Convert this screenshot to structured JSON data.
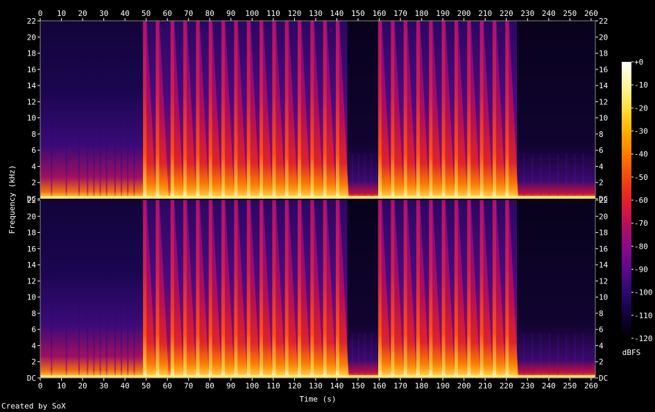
{
  "chart_data": {
    "type": "heatmap",
    "title": "",
    "xlabel": "Time (s)",
    "ylabel": "Frequency (kHz)",
    "xlim": [
      0,
      262
    ],
    "ylim": [
      0,
      22
    ],
    "x_ticks": [
      0,
      10,
      20,
      30,
      40,
      50,
      60,
      70,
      80,
      90,
      100,
      110,
      120,
      130,
      140,
      150,
      160,
      170,
      180,
      190,
      200,
      210,
      220,
      230,
      240,
      250,
      260
    ],
    "channels": [
      {
        "y_ticks": [
          {
            "value": 0,
            "label": "DC"
          },
          {
            "value": 2,
            "label": "2"
          },
          {
            "value": 4,
            "label": "4"
          },
          {
            "value": 6,
            "label": "6"
          },
          {
            "value": 8,
            "label": "8"
          },
          {
            "value": 10,
            "label": "10"
          },
          {
            "value": 12,
            "label": "12"
          },
          {
            "value": 14,
            "label": "14"
          },
          {
            "value": 16,
            "label": "16"
          },
          {
            "value": 18,
            "label": "18"
          },
          {
            "value": 20,
            "label": "20"
          },
          {
            "value": 22,
            "label": "22"
          }
        ]
      },
      {
        "y_ticks": [
          {
            "value": 0,
            "label": "DC"
          },
          {
            "value": 2,
            "label": "2"
          },
          {
            "value": 4,
            "label": "4"
          },
          {
            "value": 6,
            "label": "6"
          },
          {
            "value": 8,
            "label": "8"
          },
          {
            "value": 10,
            "label": "10"
          },
          {
            "value": 12,
            "label": "12"
          },
          {
            "value": 14,
            "label": "14"
          },
          {
            "value": 16,
            "label": "16"
          },
          {
            "value": 18,
            "label": "18"
          },
          {
            "value": 20,
            "label": "20"
          },
          {
            "value": 22,
            "label": "22"
          }
        ]
      }
    ],
    "colorbar": {
      "label": "dBFS",
      "range": [
        -120,
        0
      ],
      "ticks": [
        {
          "value": 0,
          "label": "+0"
        },
        {
          "value": -10,
          "label": "-10"
        },
        {
          "value": -20,
          "label": "-20"
        },
        {
          "value": -30,
          "label": "-30"
        },
        {
          "value": -40,
          "label": "-40"
        },
        {
          "value": -50,
          "label": "-50"
        },
        {
          "value": -60,
          "label": "-60"
        },
        {
          "value": -70,
          "label": "-70"
        },
        {
          "value": -80,
          "label": "-80"
        },
        {
          "value": -90,
          "label": "-90"
        },
        {
          "value": -100,
          "label": "-100"
        },
        {
          "value": -110,
          "label": "-110"
        },
        {
          "value": -120,
          "label": "-120"
        }
      ],
      "colors": [
        "#000000",
        "#14003a",
        "#2a0a6e",
        "#5a0a8a",
        "#8a0a88",
        "#b8105a",
        "#e0202a",
        "#f04a10",
        "#ff7a00",
        "#ffb000",
        "#ffe040",
        "#fff6a0",
        "#ffffff"
      ]
    },
    "segments": [
      {
        "t0": 0,
        "t1": 49,
        "character": "quiet intro, soft onsets"
      },
      {
        "t0": 49,
        "t1": 145,
        "character": "strong percussive onsets"
      },
      {
        "t0": 145,
        "t1": 160,
        "character": "sparse, low energy"
      },
      {
        "t0": 160,
        "t1": 225,
        "character": "strong percussive onsets"
      },
      {
        "t0": 225,
        "t1": 262,
        "character": "sparse, low energy"
      }
    ],
    "strong_onsets": [
      49,
      55,
      62,
      68,
      74,
      80,
      86,
      92,
      98,
      104,
      110,
      116,
      122,
      128,
      134,
      140,
      160,
      166,
      172,
      178,
      184,
      190,
      196,
      202,
      208,
      214,
      220
    ],
    "weak_onsets": [
      5,
      12,
      18,
      22,
      25,
      28,
      31,
      35,
      38,
      41,
      44,
      147,
      150,
      153,
      156,
      228,
      232,
      236,
      240,
      244,
      248,
      252,
      256
    ]
  },
  "credit": "Created by SoX"
}
